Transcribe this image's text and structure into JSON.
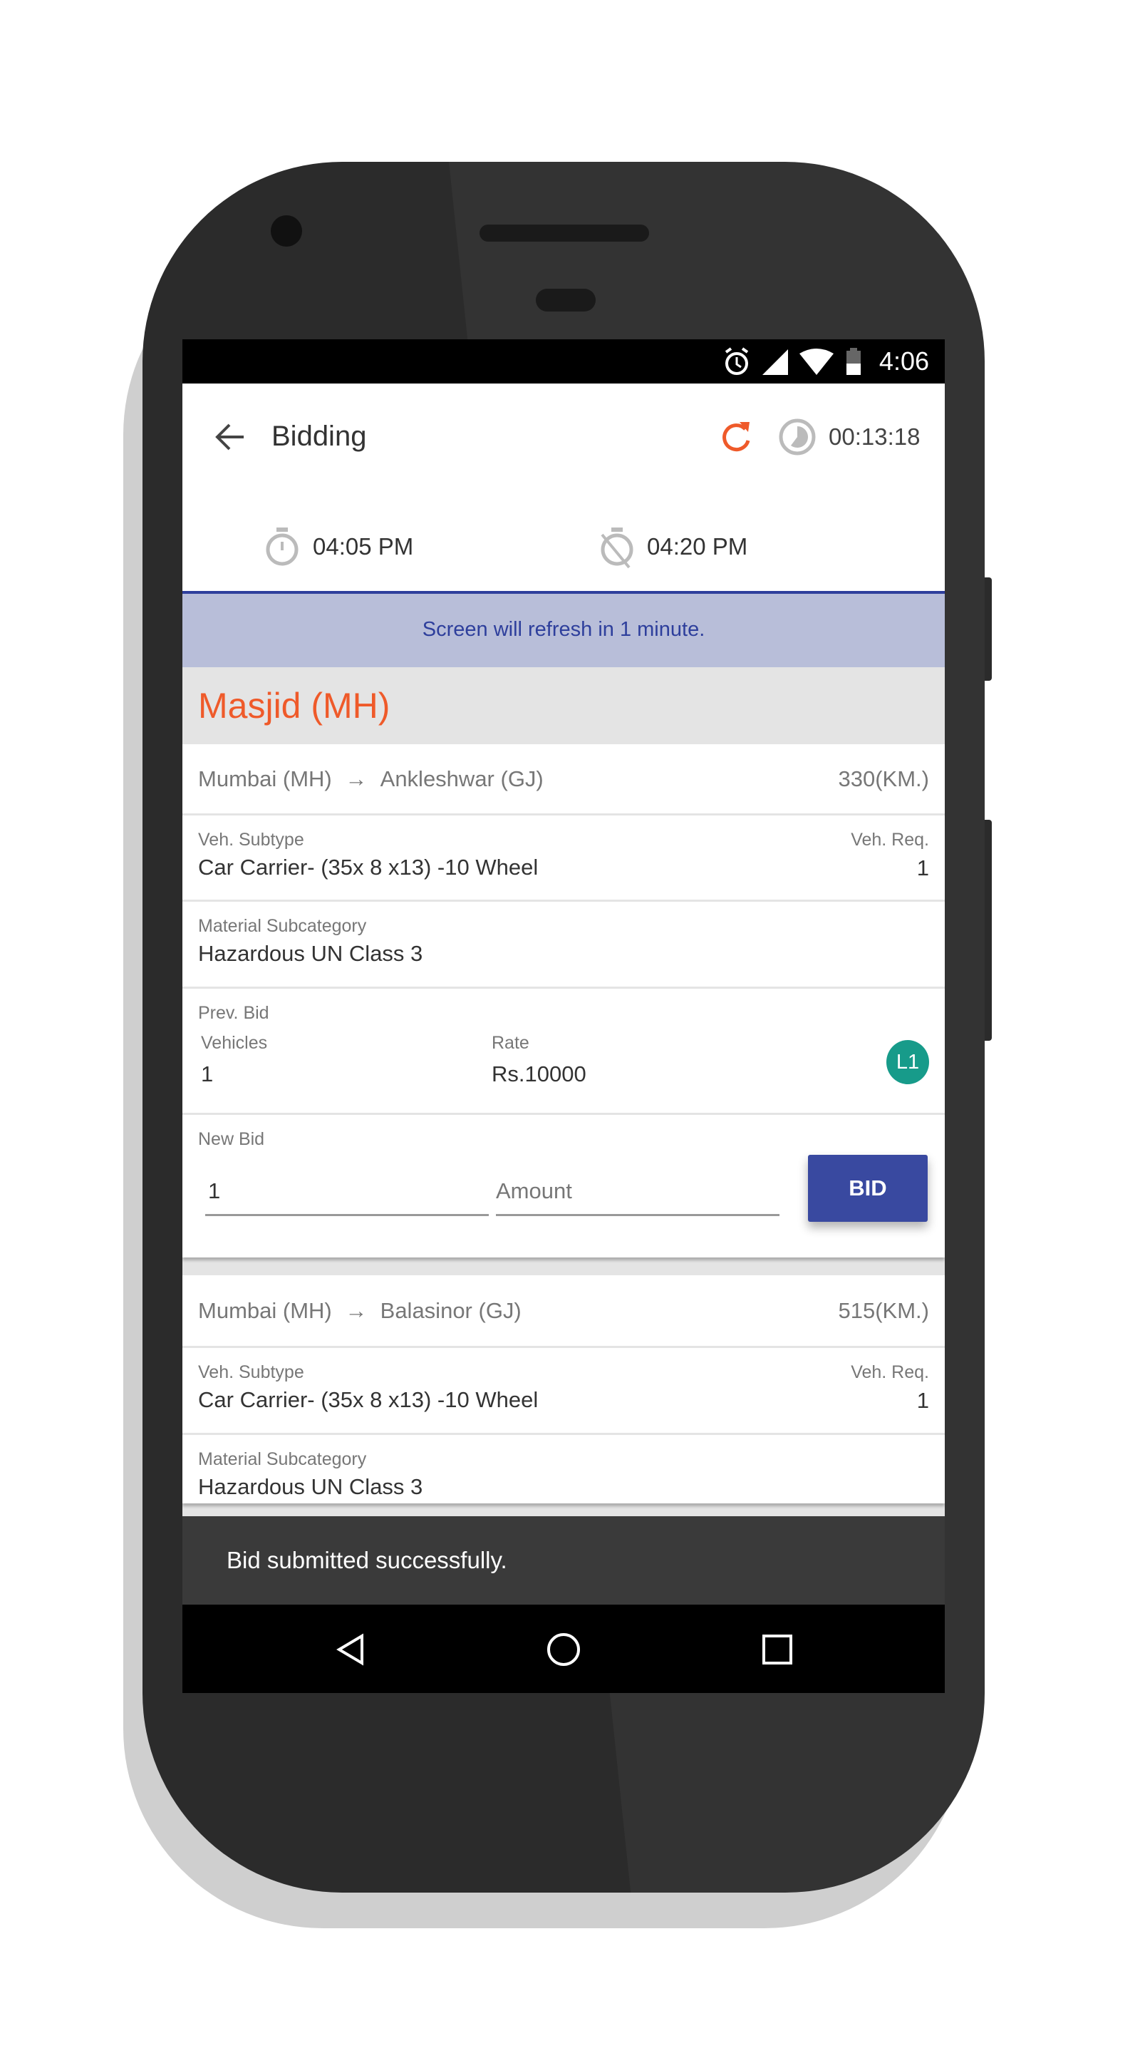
{
  "status_bar": {
    "time": "4:06",
    "icons": [
      "alarm-icon",
      "signal-icon",
      "wifi-icon",
      "battery-icon"
    ]
  },
  "app_bar": {
    "title": "Bidding",
    "timer": "00:13:18",
    "start_time": "04:05 PM",
    "end_time": "04:20 PM"
  },
  "banner": {
    "text": "Screen will refresh in 1 minute."
  },
  "group": {
    "title": "Masjid (MH)"
  },
  "cards": [
    {
      "origin": "Mumbai (MH)",
      "destination": "Ankleshwar (GJ)",
      "distance": "330(KM.)",
      "veh_subtype_label": "Veh. Subtype",
      "veh_subtype": "Car Carrier- (35x 8 x13) -10 Wheel",
      "veh_req_label": "Veh. Req.",
      "veh_req": "1",
      "material_label": "Material Subcategory",
      "material": "Hazardous UN Class 3",
      "prev_bid_label": "Prev. Bid",
      "vehicles_label": "Vehicles",
      "vehicles": "1",
      "rate_label": "Rate",
      "rate": "Rs.10000",
      "rank": "L1",
      "new_bid_label": "New Bid",
      "new_bid_vehicles": "1",
      "amount_placeholder": "Amount",
      "bid_button": "BID"
    },
    {
      "origin": "Mumbai (MH)",
      "destination": "Balasinor (GJ)",
      "distance": "515(KM.)",
      "veh_subtype_label": "Veh. Subtype",
      "veh_subtype": "Car Carrier- (35x 8 x13) -10 Wheel",
      "veh_req_label": "Veh. Req.",
      "veh_req": "1",
      "material_label": "Material Subcategory",
      "material": "Hazardous UN Class 3"
    }
  ],
  "snackbar": {
    "text": "Bid submitted successfully."
  },
  "colors": {
    "accent": "#ef5a2a",
    "primary": "#3949a0",
    "rank_badge": "#179b8a",
    "banner_bg": "#b8bed9"
  }
}
